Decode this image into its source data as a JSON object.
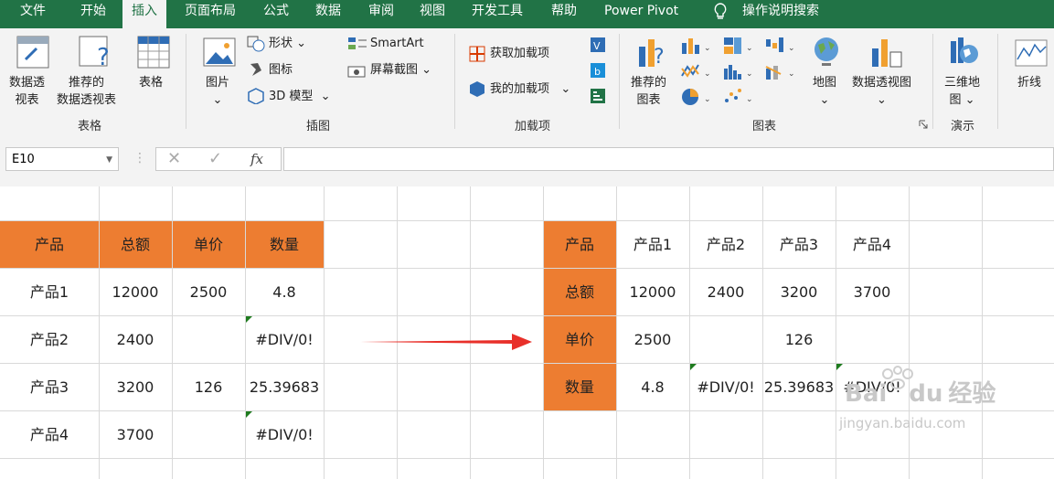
{
  "tabs": [
    "文件",
    "开始",
    "插入",
    "页面布局",
    "公式",
    "数据",
    "审阅",
    "视图",
    "开发工具",
    "帮助",
    "Power Pivot",
    "操作说明搜索"
  ],
  "ribbon": {
    "pivot_table": [
      "数据透",
      "视表"
    ],
    "recommended_pivot": [
      "推荐的",
      "数据透视表"
    ],
    "table": "表格",
    "picture": "图片",
    "shapes": "形状",
    "icons": "图标",
    "model3d": "3D 模型",
    "smartart": "SmartArt",
    "screenshot": "屏幕截图",
    "get_addins": "获取加载项",
    "my_addins": "我的加载项",
    "recommended_charts": [
      "推荐的",
      "图表"
    ],
    "maps": "地图",
    "pivot_chart": "数据透视图",
    "map3d": [
      "三维地",
      "图"
    ],
    "line": "折线",
    "groups": {
      "tables": "表格",
      "illustrations": "插图",
      "addins": "加载项",
      "charts": "图表",
      "tours": "演示"
    }
  },
  "formula_bar": {
    "name_box": "E10",
    "fx": "fx",
    "formula": ""
  },
  "left_table": {
    "headers": [
      "产品",
      "总额",
      "单价",
      "数量"
    ],
    "rows": [
      [
        "产品1",
        "12000",
        "2500",
        "4.8"
      ],
      [
        "产品2",
        "2400",
        "",
        "#DIV/0!"
      ],
      [
        "产品3",
        "3200",
        "126",
        "25.39683"
      ],
      [
        "产品4",
        "3700",
        "",
        "#DIV/0!"
      ]
    ]
  },
  "right_table": {
    "row_headers": [
      "产品",
      "总额",
      "单价",
      "数量"
    ],
    "rows": [
      [
        "产品1",
        "产品2",
        "产品3",
        "产品4"
      ],
      [
        "12000",
        "2400",
        "3200",
        "3700"
      ],
      [
        "2500",
        "",
        "126",
        ""
      ],
      [
        "4.8",
        "#DIV/0!",
        "25.39683",
        "#DIV/0!"
      ]
    ]
  },
  "watermark": {
    "brand": "Bai",
    "du": "du",
    "jingyan": "经验",
    "url": "jingyan.baidu.com"
  },
  "colors": {
    "excel_green": "#217346",
    "header_orange": "#ed7d31",
    "arrow_red": "#e8302a"
  }
}
